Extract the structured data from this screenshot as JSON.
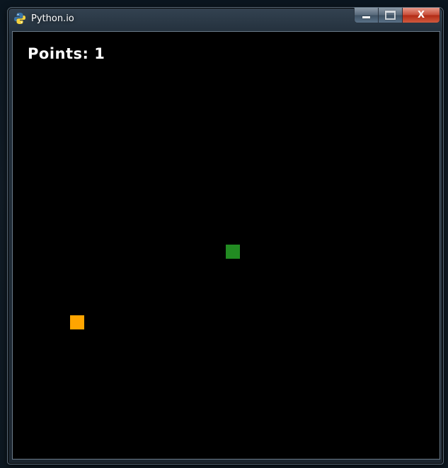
{
  "window": {
    "title": "Python.io",
    "controls": {
      "minimize": "",
      "maximize": "",
      "close": "X"
    }
  },
  "game": {
    "score_text": "Points: 1",
    "colors": {
      "background": "#000000",
      "food": "#FFA500",
      "snake": "#228B22",
      "score_text": "#FFFFFF"
    }
  }
}
